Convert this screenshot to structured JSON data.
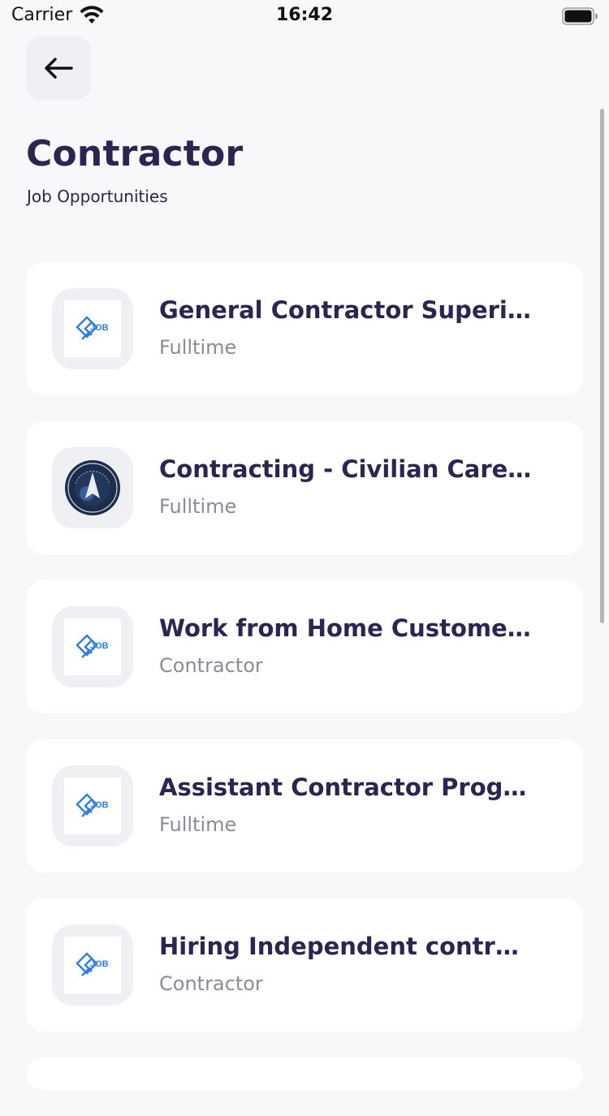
{
  "status_bar": {
    "carrier": "Carrier",
    "time": "16:42"
  },
  "header": {
    "title": "Contractor",
    "subtitle": "Job Opportunities"
  },
  "jobs": [
    {
      "title": "General Contractor Superintendent",
      "type": "Fulltime",
      "logo": "job-logo-icon"
    },
    {
      "title": "Contracting  - Civilian Career",
      "type": "Fulltime",
      "logo": "space-force-seal-icon"
    },
    {
      "title": "Work from Home Customer Service",
      "type": "Contractor",
      "logo": "job-logo-icon"
    },
    {
      "title": "Assistant Contractor Program Manager",
      "type": "Fulltime",
      "logo": "job-logo-icon"
    },
    {
      "title": "Hiring Independent contractors",
      "type": "Contractor",
      "logo": "job-logo-icon"
    }
  ],
  "colors": {
    "background": "#f8f8fb",
    "title": "#2d2450",
    "muted": "#8a8a9a",
    "tile": "#eef0f4",
    "brand_blue": "#2f7de1"
  }
}
